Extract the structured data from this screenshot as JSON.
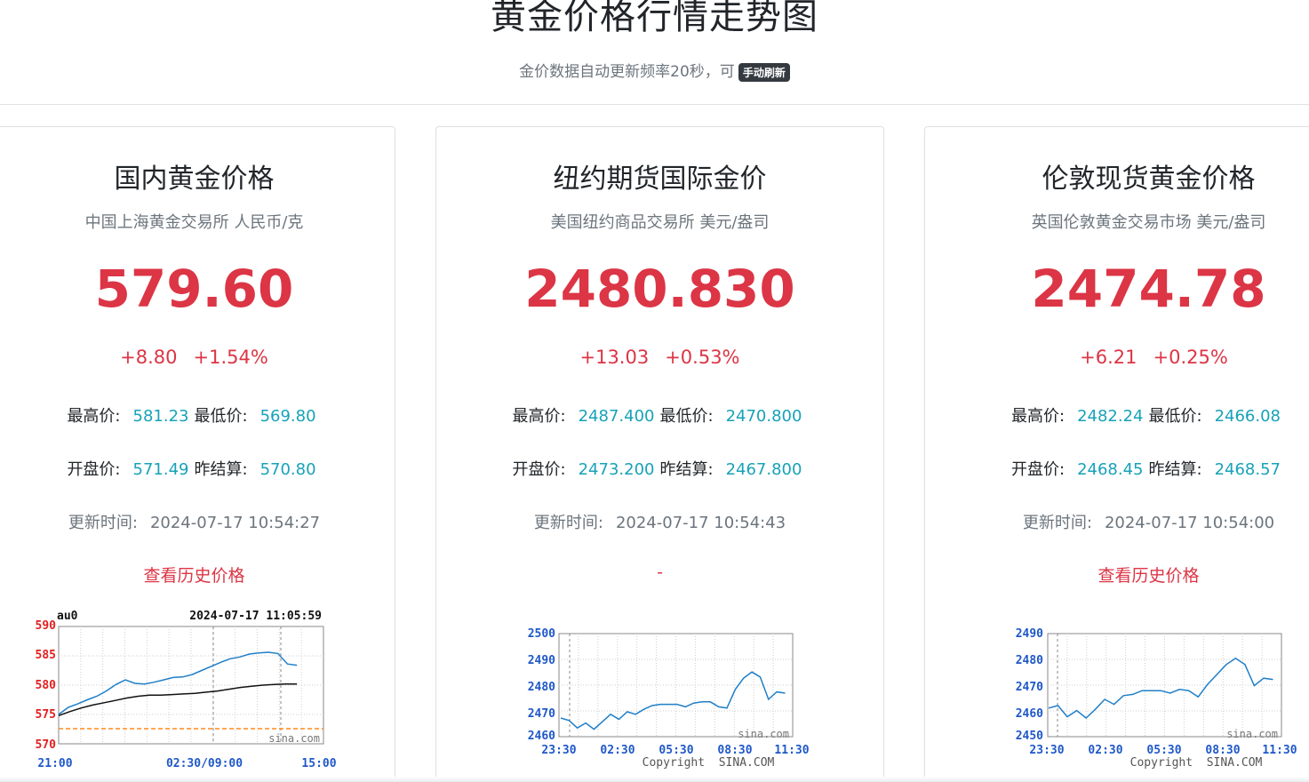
{
  "page": {
    "title": "黄金价格行情走势图",
    "subtitle": "金价数据自动更新频率20秒，可",
    "refresh_button": "手动刷新"
  },
  "labels": {
    "high": "最高价:",
    "low": "最低价:",
    "open": "开盘价:",
    "prev_settle": "昨结算:",
    "updated": "更新时间:"
  },
  "cards": [
    {
      "title": "国内黄金价格",
      "subtitle": "中国上海黄金交易所 人民币/克",
      "price": "579.60",
      "change": "+8.80",
      "change_pct": "+1.54%",
      "high": "581.23",
      "low": "569.80",
      "open": "571.49",
      "prev_settle": "570.80",
      "updated_time": "2024-07-17 10:54:27",
      "history_link": "查看历史价格"
    },
    {
      "title": "纽约期货国际金价",
      "subtitle": "美国纽约商品交易所 美元/盎司",
      "price": "2480.830",
      "change": "+13.03",
      "change_pct": "+0.53%",
      "high": "2487.400",
      "low": "2470.800",
      "open": "2473.200",
      "prev_settle": "2467.800",
      "updated_time": "2024-07-17 10:54:43",
      "history_link": "-"
    },
    {
      "title": "伦敦现货黄金价格",
      "subtitle": "英国伦敦黄金交易市场 美元/盎司",
      "price": "2474.78",
      "change": "+6.21",
      "change_pct": "+0.25%",
      "high": "2482.24",
      "low": "2466.08",
      "open": "2468.45",
      "prev_settle": "2468.57",
      "updated_time": "2024-07-17 10:54:00",
      "history_link": "查看历史价格"
    }
  ],
  "charts": {
    "sh": {
      "symbol": "au0",
      "timestamp": "2024-07-17 11:05:59",
      "y_ticks": [
        "590",
        "585",
        "580",
        "575",
        "570"
      ],
      "x_ticks": [
        "21:00",
        "02:30/09:00",
        "15:00"
      ],
      "watermark": "sina.com"
    },
    "ny": {
      "y_ticks": [
        "2500",
        "2490",
        "2480",
        "2470",
        "2460"
      ],
      "x_ticks": [
        "23:30",
        "02:30",
        "05:30",
        "08:30",
        "11:30"
      ],
      "watermark": "sina.com",
      "copyright": "Copyright  SINA.COM"
    },
    "ldn": {
      "y_ticks": [
        "2490",
        "2480",
        "2470",
        "2460",
        "2450"
      ],
      "x_ticks": [
        "23:30",
        "02:30",
        "05:30",
        "08:30",
        "11:30"
      ],
      "watermark": "sina.com",
      "copyright": "Copyright  SINA.COM"
    }
  },
  "chart_data": [
    {
      "type": "line",
      "y_ticks": [
        590,
        585,
        580,
        575,
        570
      ],
      "ylim": [
        570,
        590
      ],
      "x_ticks": [
        "21:00",
        "02:30/09:00",
        "15:00"
      ],
      "series": [
        {
          "values": [
            575.0,
            576.2,
            576.8,
            577.5,
            578.1,
            579.0,
            580.1,
            580.9,
            580.3,
            580.2,
            580.5,
            580.9,
            581.3,
            581.4,
            581.8,
            582.5,
            583.2,
            583.9,
            584.5,
            584.8,
            585.3,
            585.5,
            585.6,
            585.4,
            583.6,
            583.4
          ]
        },
        {
          "values": [
            574.8,
            575.5,
            576.1,
            576.6,
            577.0,
            577.4,
            577.8,
            578.1,
            578.3,
            578.3,
            578.4,
            578.5,
            578.6,
            578.8,
            579.0,
            579.3,
            579.6,
            579.8,
            580.0,
            580.1,
            580.2,
            580.2
          ]
        }
      ]
    },
    {
      "type": "line",
      "y_ticks": [
        2500,
        2490,
        2480,
        2470,
        2460
      ],
      "ylim": [
        2460,
        2500
      ],
      "x_ticks": [
        "23:30",
        "02:30",
        "05:30",
        "08:30",
        "11:30"
      ],
      "series": [
        {
          "values": [
            2467.5,
            2466.5,
            2463.5,
            2465.5,
            2463.0,
            2466.0,
            2469.0,
            2467.0,
            2470.0,
            2469.0,
            2471.0,
            2472.5,
            2473.0,
            2473.0,
            2473.0,
            2472.0,
            2473.5,
            2474.0,
            2474.0,
            2472.0,
            2471.5,
            2479.0,
            2483.5,
            2486.0,
            2484.0,
            2475.0,
            2478.0,
            2477.5
          ]
        }
      ]
    },
    {
      "type": "line",
      "y_ticks": [
        2490,
        2480,
        2470,
        2460,
        2450
      ],
      "ylim": [
        2450,
        2490
      ],
      "x_ticks": [
        "23:30",
        "02:30",
        "05:30",
        "08:30",
        "11:30"
      ],
      "series": [
        {
          "values": [
            2461.5,
            2462.5,
            2458.0,
            2460.5,
            2457.5,
            2461.0,
            2465.0,
            2463.0,
            2466.5,
            2467.0,
            2468.5,
            2468.5,
            2468.5,
            2467.5,
            2469.0,
            2468.5,
            2466.0,
            2471.0,
            2475.0,
            2479.0,
            2481.5,
            2479.0,
            2470.5,
            2473.5,
            2473.0
          ]
        }
      ]
    }
  ]
}
